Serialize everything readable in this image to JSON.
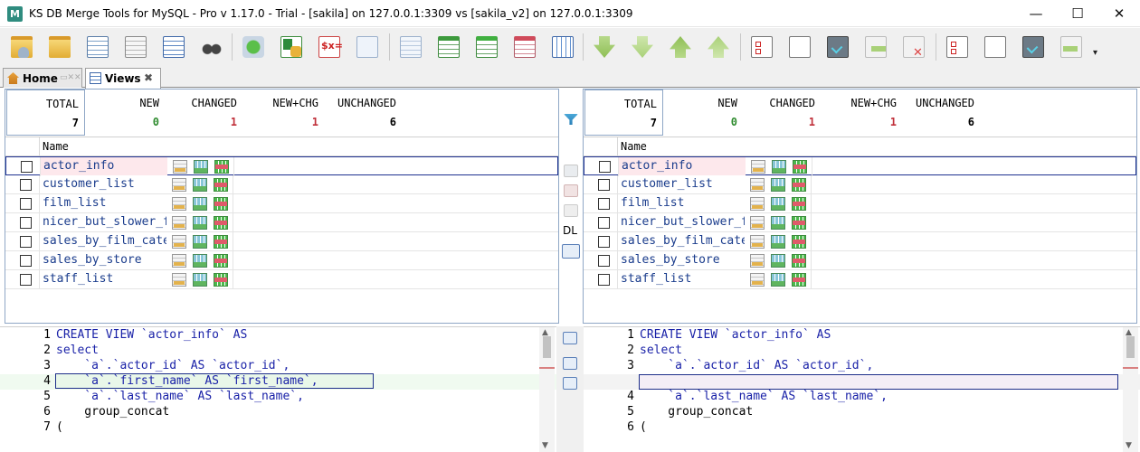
{
  "window": {
    "title": "KS DB Merge Tools for MySQL - Pro v 1.17.0 - Trial - [sakila] on 127.0.0.1:3309 vs [sakila_v2] on 127.0.0.1:3309",
    "minimize": "—",
    "maximize": "☐",
    "close": "✕"
  },
  "tabs": [
    {
      "label": "Home",
      "close": ""
    },
    {
      "label": "Views",
      "close": "✖"
    }
  ],
  "left": {
    "stats": {
      "total": {
        "label": "TOTAL",
        "value": "7"
      },
      "new": {
        "label": "NEW",
        "value": "0"
      },
      "changed": {
        "label": "CHANGED",
        "value": "1"
      },
      "new_chg": {
        "label": "NEW+CHG",
        "value": "1"
      },
      "unchanged": {
        "label": "UNCHANGED",
        "value": "6"
      }
    },
    "column_header": "Name",
    "rows": [
      "actor_info",
      "customer_list",
      "film_list",
      "nicer_but_slower_film_list",
      "sales_by_film_category",
      "sales_by_store",
      "staff_list"
    ],
    "code": [
      {
        "n": "1",
        "text": "CREATE VIEW `actor_info` AS"
      },
      {
        "n": "2",
        "text": "select"
      },
      {
        "n": "3",
        "text": "    `a`.`actor_id` AS `actor_id`,"
      },
      {
        "n": "4",
        "text": "    `a`.`first_name` AS `first_name`,"
      },
      {
        "n": "5",
        "text": "    `a`.`last_name` AS `last_name`,"
      },
      {
        "n": "6",
        "text": "    group_concat"
      },
      {
        "n": "7",
        "text": "("
      }
    ]
  },
  "right": {
    "stats": {
      "total": {
        "label": "TOTAL",
        "value": "7"
      },
      "new": {
        "label": "NEW",
        "value": "0"
      },
      "changed": {
        "label": "CHANGED",
        "value": "1"
      },
      "new_chg": {
        "label": "NEW+CHG",
        "value": "1"
      },
      "unchanged": {
        "label": "UNCHANGED",
        "value": "6"
      }
    },
    "column_header": "Name",
    "rows": [
      "actor_info",
      "customer_list",
      "film_list",
      "nicer_but_slower_film_list",
      "sales_by_film_category",
      "sales_by_store",
      "staff_list"
    ],
    "code": [
      {
        "n": "1",
        "text": "CREATE VIEW `actor_info` AS"
      },
      {
        "n": "2",
        "text": "select"
      },
      {
        "n": "3",
        "text": "    `a`.`actor_id` AS `actor_id`,"
      },
      {
        "n": "",
        "text": ""
      },
      {
        "n": "4",
        "text": "    `a`.`last_name` AS `last_name`,"
      },
      {
        "n": "5",
        "text": "    group_concat"
      },
      {
        "n": "6",
        "text": "("
      }
    ]
  },
  "middle": {
    "dl_label": "DL"
  },
  "colors": {
    "new": "#2e8b2e",
    "changed": "#c0303a",
    "new_chg": "#c0303a",
    "selection_border": "#1d2f8f",
    "changed_row_bg": "#fde8ec"
  },
  "toolbar_icons": [
    "open-folder-db-icon",
    "open-folder-icon",
    "copy-grid-icon",
    "select-script-icon",
    "settings-grid-icon",
    "binoculars-icon",
    "refresh-icon",
    "excel-export-icon",
    "variables-icon",
    "copy-document-icon",
    "grid-blank-icon",
    "grid-green-icon",
    "grid-green-header-icon",
    "grid-red-icon",
    "grid-blue-icon",
    "merge-down-icon",
    "merge-down-light-icon",
    "merge-up-icon",
    "merge-up-light-icon",
    "checklist-icon",
    "document-icon",
    "checklist-dark-icon",
    "copy-right-icon",
    "cancel-check-icon",
    "checklist-2-icon",
    "document-2-icon",
    "checklist-dark-2-icon",
    "copy-left-icon"
  ]
}
